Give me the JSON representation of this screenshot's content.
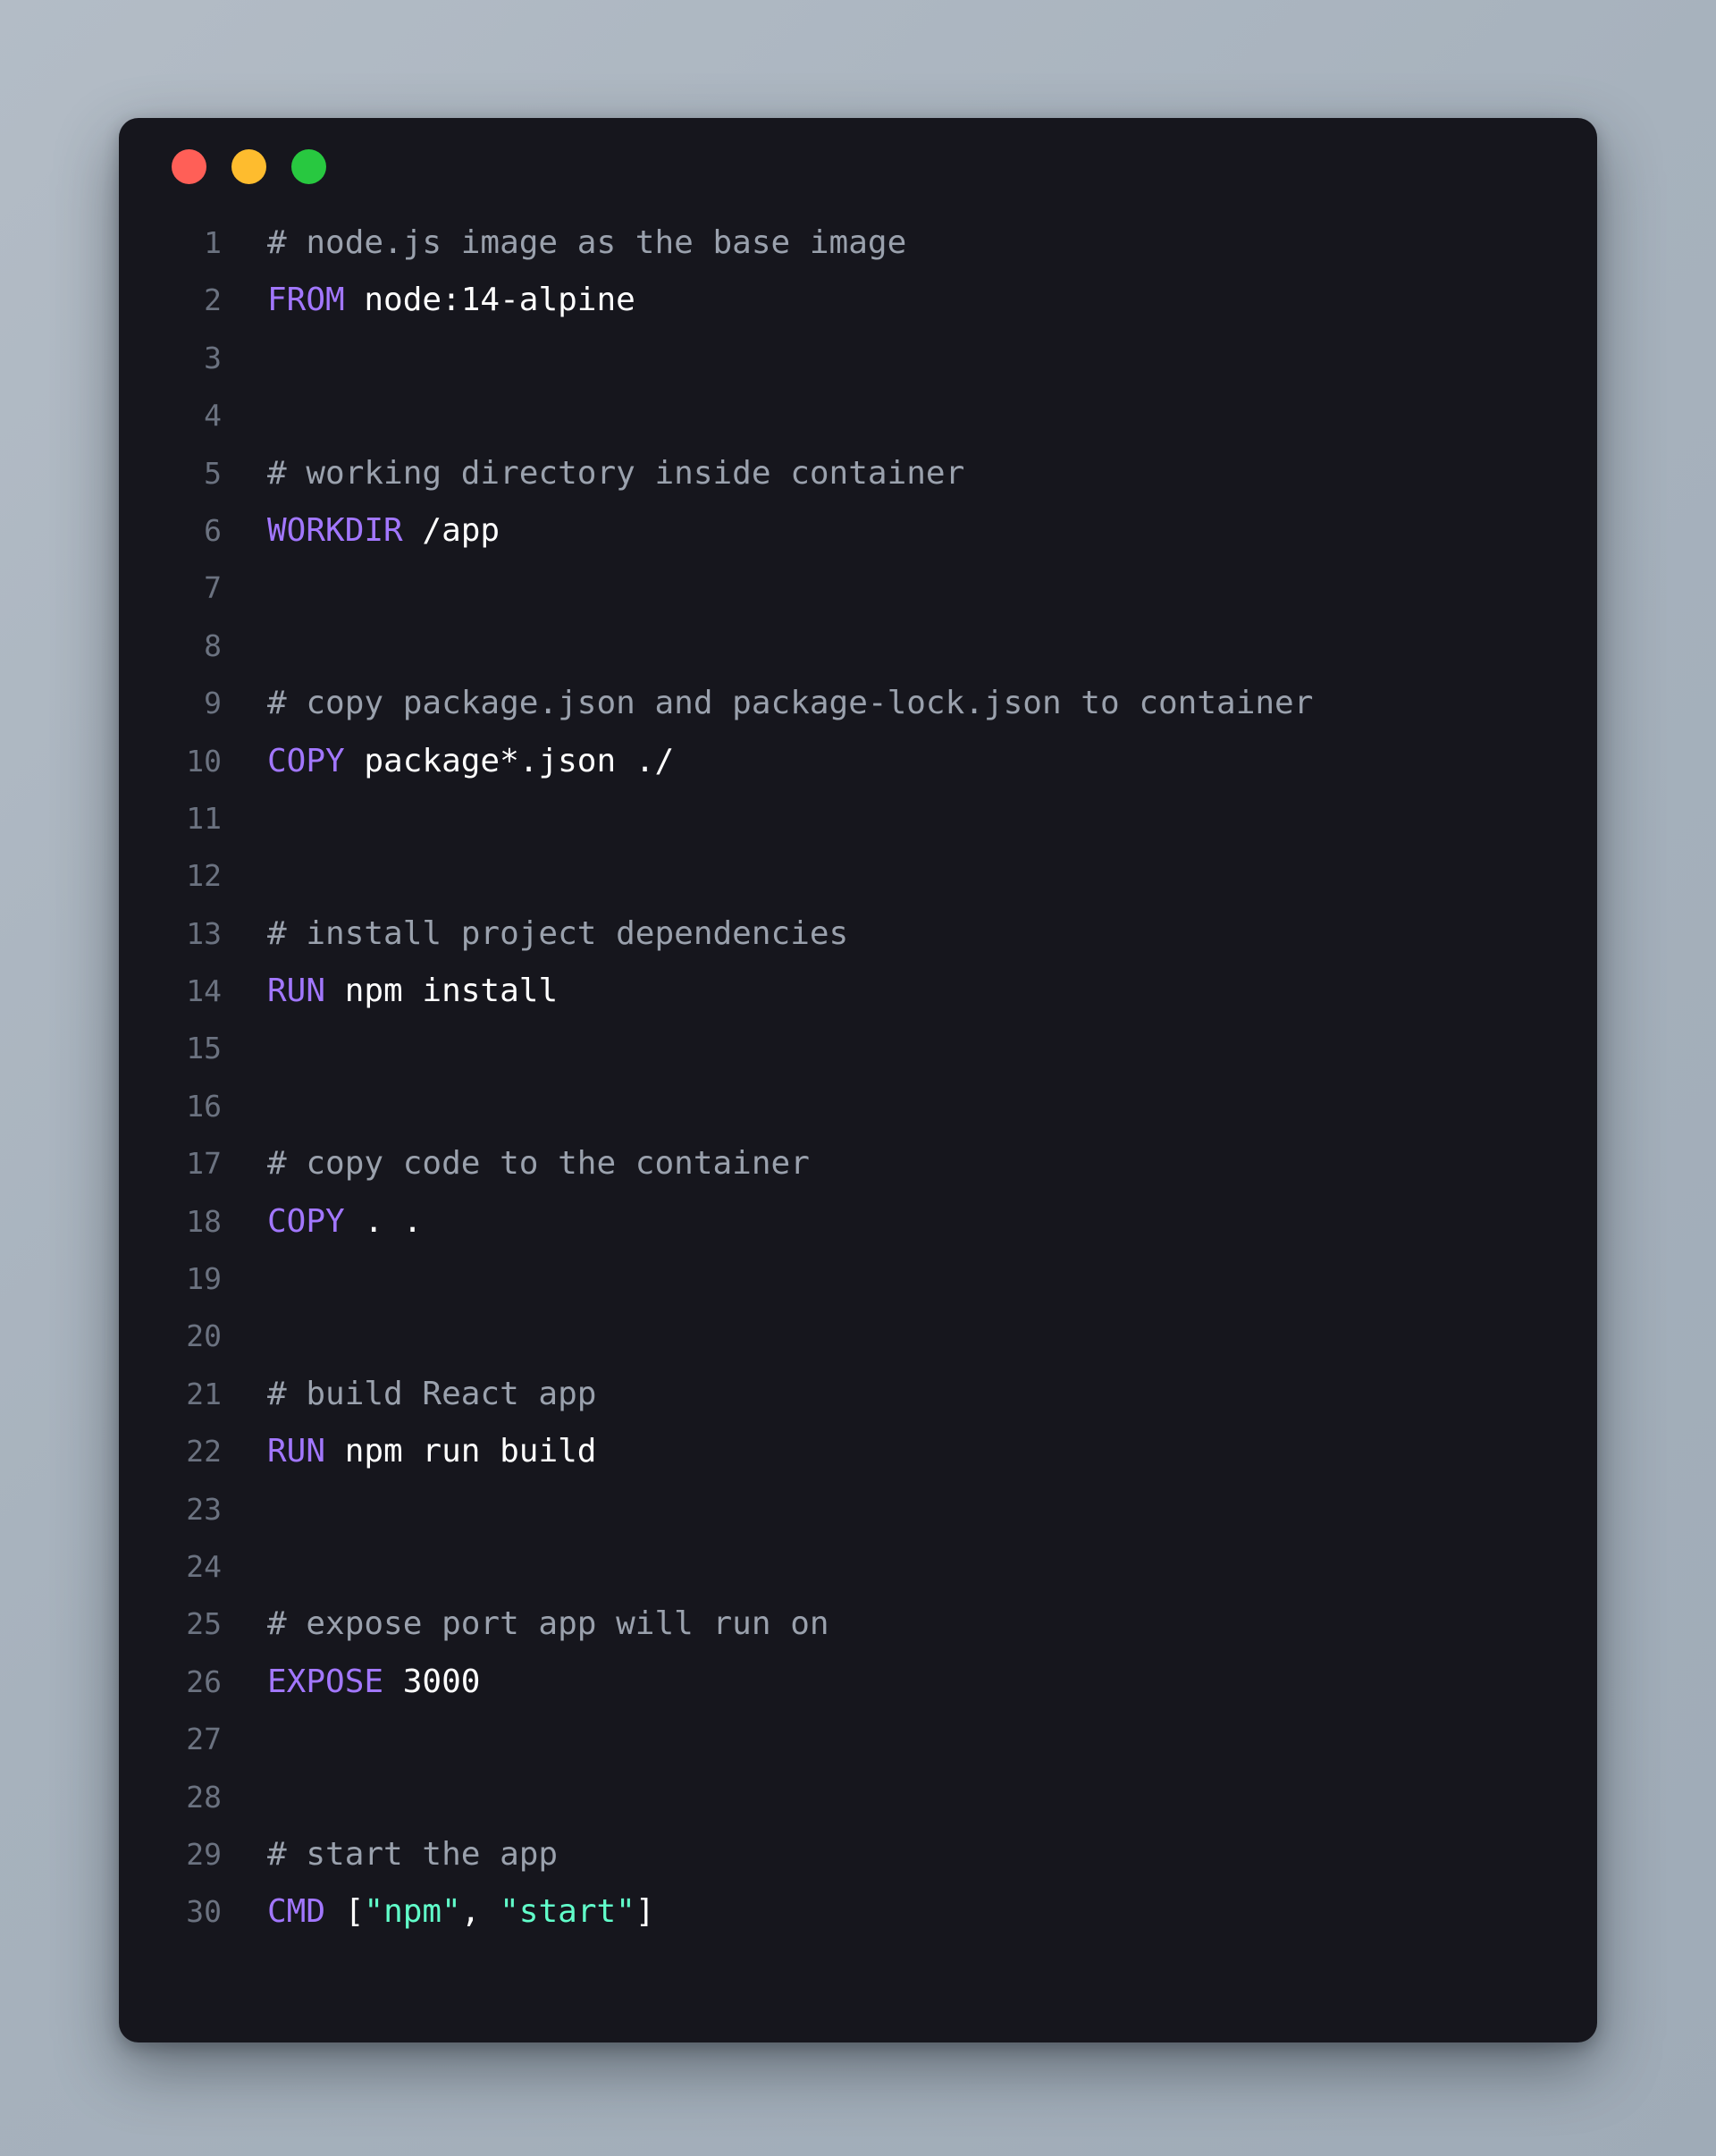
{
  "window": {
    "traffic_lights": [
      {
        "name": "close",
        "color": "#ff5f57"
      },
      {
        "name": "minimize",
        "color": "#febc2e"
      },
      {
        "name": "maximize",
        "color": "#28c840"
      }
    ]
  },
  "theme": {
    "background": "#a7b2bd",
    "card_background": "#16161d",
    "comment_color": "#9aa1ad",
    "keyword_color": "#a277ff",
    "string_color": "#61ffca",
    "text_color": "#ffffff",
    "line_number_color": "#6b7280"
  },
  "editor": {
    "language": "dockerfile",
    "total_lines": 30,
    "lines": [
      {
        "number": "1",
        "tokens": [
          {
            "type": "comment",
            "text": "# node.js image as the base image"
          }
        ]
      },
      {
        "number": "2",
        "tokens": [
          {
            "type": "keyword",
            "text": "FROM"
          },
          {
            "type": "plain",
            "text": " node:14-alpine"
          }
        ]
      },
      {
        "number": "3",
        "tokens": []
      },
      {
        "number": "4",
        "tokens": []
      },
      {
        "number": "5",
        "tokens": [
          {
            "type": "comment",
            "text": "# working directory inside container"
          }
        ]
      },
      {
        "number": "6",
        "tokens": [
          {
            "type": "keyword",
            "text": "WORKDIR"
          },
          {
            "type": "plain",
            "text": " /app"
          }
        ]
      },
      {
        "number": "7",
        "tokens": []
      },
      {
        "number": "8",
        "tokens": []
      },
      {
        "number": "9",
        "tokens": [
          {
            "type": "comment",
            "text": "# copy package.json and package-lock.json to container"
          }
        ]
      },
      {
        "number": "10",
        "tokens": [
          {
            "type": "keyword",
            "text": "COPY"
          },
          {
            "type": "plain",
            "text": " package*.json ./"
          }
        ]
      },
      {
        "number": "11",
        "tokens": []
      },
      {
        "number": "12",
        "tokens": []
      },
      {
        "number": "13",
        "tokens": [
          {
            "type": "comment",
            "text": "# install project dependencies"
          }
        ]
      },
      {
        "number": "14",
        "tokens": [
          {
            "type": "keyword",
            "text": "RUN"
          },
          {
            "type": "plain",
            "text": " npm install"
          }
        ]
      },
      {
        "number": "15",
        "tokens": []
      },
      {
        "number": "16",
        "tokens": []
      },
      {
        "number": "17",
        "tokens": [
          {
            "type": "comment",
            "text": "# copy code to the container"
          }
        ]
      },
      {
        "number": "18",
        "tokens": [
          {
            "type": "keyword",
            "text": "COPY"
          },
          {
            "type": "plain",
            "text": " . ."
          }
        ]
      },
      {
        "number": "19",
        "tokens": []
      },
      {
        "number": "20",
        "tokens": []
      },
      {
        "number": "21",
        "tokens": [
          {
            "type": "comment",
            "text": "# build React app"
          }
        ]
      },
      {
        "number": "22",
        "tokens": [
          {
            "type": "keyword",
            "text": "RUN"
          },
          {
            "type": "plain",
            "text": " npm run build"
          }
        ]
      },
      {
        "number": "23",
        "tokens": []
      },
      {
        "number": "24",
        "tokens": []
      },
      {
        "number": "25",
        "tokens": [
          {
            "type": "comment",
            "text": "# expose port app will run on"
          }
        ]
      },
      {
        "number": "26",
        "tokens": [
          {
            "type": "keyword",
            "text": "EXPOSE"
          },
          {
            "type": "plain",
            "text": " 3000"
          }
        ]
      },
      {
        "number": "27",
        "tokens": []
      },
      {
        "number": "28",
        "tokens": []
      },
      {
        "number": "29",
        "tokens": [
          {
            "type": "comment",
            "text": "# start the app"
          }
        ]
      },
      {
        "number": "30",
        "tokens": [
          {
            "type": "keyword",
            "text": "CMD"
          },
          {
            "type": "punct",
            "text": " ["
          },
          {
            "type": "string",
            "text": "\"npm\""
          },
          {
            "type": "punct",
            "text": ", "
          },
          {
            "type": "string",
            "text": "\"start\""
          },
          {
            "type": "punct",
            "text": "]"
          }
        ]
      }
    ]
  }
}
